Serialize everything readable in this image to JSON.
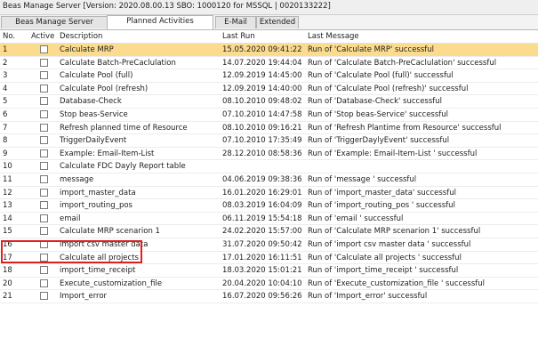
{
  "window": {
    "title": "Beas Manage Server [Version: 2020.08.00.13 SBO: 1000120 for MSSQL | 0020133222]"
  },
  "tabs": [
    {
      "label": "Beas Manage Server",
      "active": false
    },
    {
      "label": "Planned Activities",
      "active": true
    },
    {
      "label": "E-Mail",
      "active": false
    },
    {
      "label": "Extended",
      "active": false
    }
  ],
  "table": {
    "headers": {
      "no": "No.",
      "active": "Active",
      "description": "Description",
      "last_run": "Last Run",
      "last_message": "Last Message"
    },
    "rows": [
      {
        "no": "1",
        "active": false,
        "description": "Calculate MRP",
        "last_run": "15.05.2020 09:41:22",
        "last_message": "Run of 'Calculate MRP' successful",
        "selected": true
      },
      {
        "no": "2",
        "active": false,
        "description": "Calculate Batch-PreCaclulation",
        "last_run": "14.07.2020 19:44:04",
        "last_message": "Run of 'Calculate Batch-PreCaclulation' successful"
      },
      {
        "no": "3",
        "active": false,
        "description": "Calculate Pool (full)",
        "last_run": "12.09.2019 14:45:00",
        "last_message": "Run of 'Calculate Pool (full)' successful"
      },
      {
        "no": "4",
        "active": false,
        "description": "Calculate Pool (refresh)",
        "last_run": "12.09.2019 14:40:00",
        "last_message": "Run of 'Calculate Pool (refresh)' successful"
      },
      {
        "no": "5",
        "active": false,
        "description": "Database-Check",
        "last_run": "08.10.2010 09:48:02",
        "last_message": "Run of 'Database-Check' successful"
      },
      {
        "no": "6",
        "active": false,
        "description": "Stop beas-Service",
        "last_run": "07.10.2010 14:47:58",
        "last_message": "Run of 'Stop beas-Service' successful"
      },
      {
        "no": "7",
        "active": false,
        "description": "Refresh planned time of Resource",
        "last_run": "08.10.2010 09:16:21",
        "last_message": "Run of 'Refresh Plantime from Resource' successful"
      },
      {
        "no": "8",
        "active": false,
        "description": "TriggerDailyEvent",
        "last_run": "07.10.2010 17:35:49",
        "last_message": "Run of 'TriggerDaylyEvent' successful"
      },
      {
        "no": "9",
        "active": false,
        "description": "Example: Email-Item-List",
        "last_run": "28.12.2010 08:58:36",
        "last_message": "Run of 'Example: Email-Item-List ' successful"
      },
      {
        "no": "10",
        "active": false,
        "description": "Calculate FDC Dayly Report table",
        "last_run": "",
        "last_message": ""
      },
      {
        "no": "11",
        "active": false,
        "description": "message",
        "last_run": "04.06.2019 09:38:36",
        "last_message": "Run of 'message ' successful"
      },
      {
        "no": "12",
        "active": false,
        "description": "import_master_data",
        "last_run": "16.01.2020 16:29:01",
        "last_message": "Run of 'import_master_data' successful"
      },
      {
        "no": "13",
        "active": false,
        "description": "import_routing_pos",
        "last_run": "08.03.2019 16:04:09",
        "last_message": "Run of 'import_routing_pos ' successful"
      },
      {
        "no": "14",
        "active": false,
        "description": "email",
        "last_run": "06.11.2019 15:54:18",
        "last_message": "Run of 'email ' successful"
      },
      {
        "no": "15",
        "active": false,
        "description": "Calculate MRP scenarion 1",
        "last_run": "24.02.2020 15:57:00",
        "last_message": "Run of 'Calculate MRP scenarion 1' successful"
      },
      {
        "no": "16",
        "active": false,
        "description": "import csv master data",
        "last_run": "31.07.2020 09:50:42",
        "last_message": "Run of 'import csv master data ' successful"
      },
      {
        "no": "17",
        "active": false,
        "description": "Calculate all projects",
        "last_run": "17.01.2020 16:11:51",
        "last_message": "Run of 'Calculate all projects ' successful"
      },
      {
        "no": "18",
        "active": false,
        "description": "import_time_receipt",
        "last_run": "18.03.2020 15:01:21",
        "last_message": "Run of 'import_time_receipt ' successful"
      },
      {
        "no": "20",
        "active": false,
        "description": "Execute_customization_file",
        "last_run": "20.04.2020 10:04:10",
        "last_message": "Run of 'Execute_customization_file ' successful"
      },
      {
        "no": "21",
        "active": false,
        "description": "Import_error",
        "last_run": "16.07.2020 09:56:26",
        "last_message": "Run of 'Import_error' successful"
      }
    ]
  },
  "colors": {
    "selected_row": "#fbdc8f",
    "highlight_box": "#e02020"
  }
}
